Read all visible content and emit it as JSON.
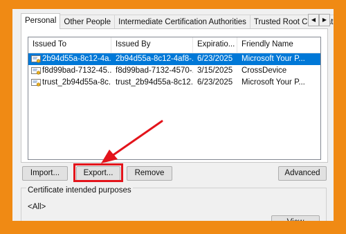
{
  "tabs": [
    "Personal",
    "Other People",
    "Intermediate Certification Authorities",
    "Trusted Root Certification"
  ],
  "columns": [
    "Issued To",
    "Issued By",
    "Expiratio...",
    "Friendly Name"
  ],
  "rows": [
    {
      "issued_to": "2b94d55a-8c12-4a...",
      "issued_by": "2b94d55a-8c12-4af8-...",
      "expiration": "6/23/2025",
      "friendly_name": "Microsoft Your P..."
    },
    {
      "issued_to": "f8d99bad-7132-45...",
      "issued_by": "f8d99bad-7132-4570-...",
      "expiration": "3/15/2025",
      "friendly_name": "CrossDevice"
    },
    {
      "issued_to": "trust_2b94d55a-8c...",
      "issued_by": "trust_2b94d55a-8c12...",
      "expiration": "6/23/2025",
      "friendly_name": "Microsoft Your P..."
    }
  ],
  "selected_row": 0,
  "buttons": {
    "import": "Import...",
    "export": "Export...",
    "remove": "Remove",
    "advanced": "Advanced",
    "view": "View"
  },
  "purposes": {
    "title": "Certificate intended purposes",
    "value": "<All>"
  },
  "colors": {
    "background": "#f08a14",
    "selection": "#0078d7",
    "highlight": "#e3141b"
  },
  "icons": [
    "scroll-left-icon",
    "scroll-right-icon",
    "certificate-icon",
    "annotation-arrow"
  ]
}
